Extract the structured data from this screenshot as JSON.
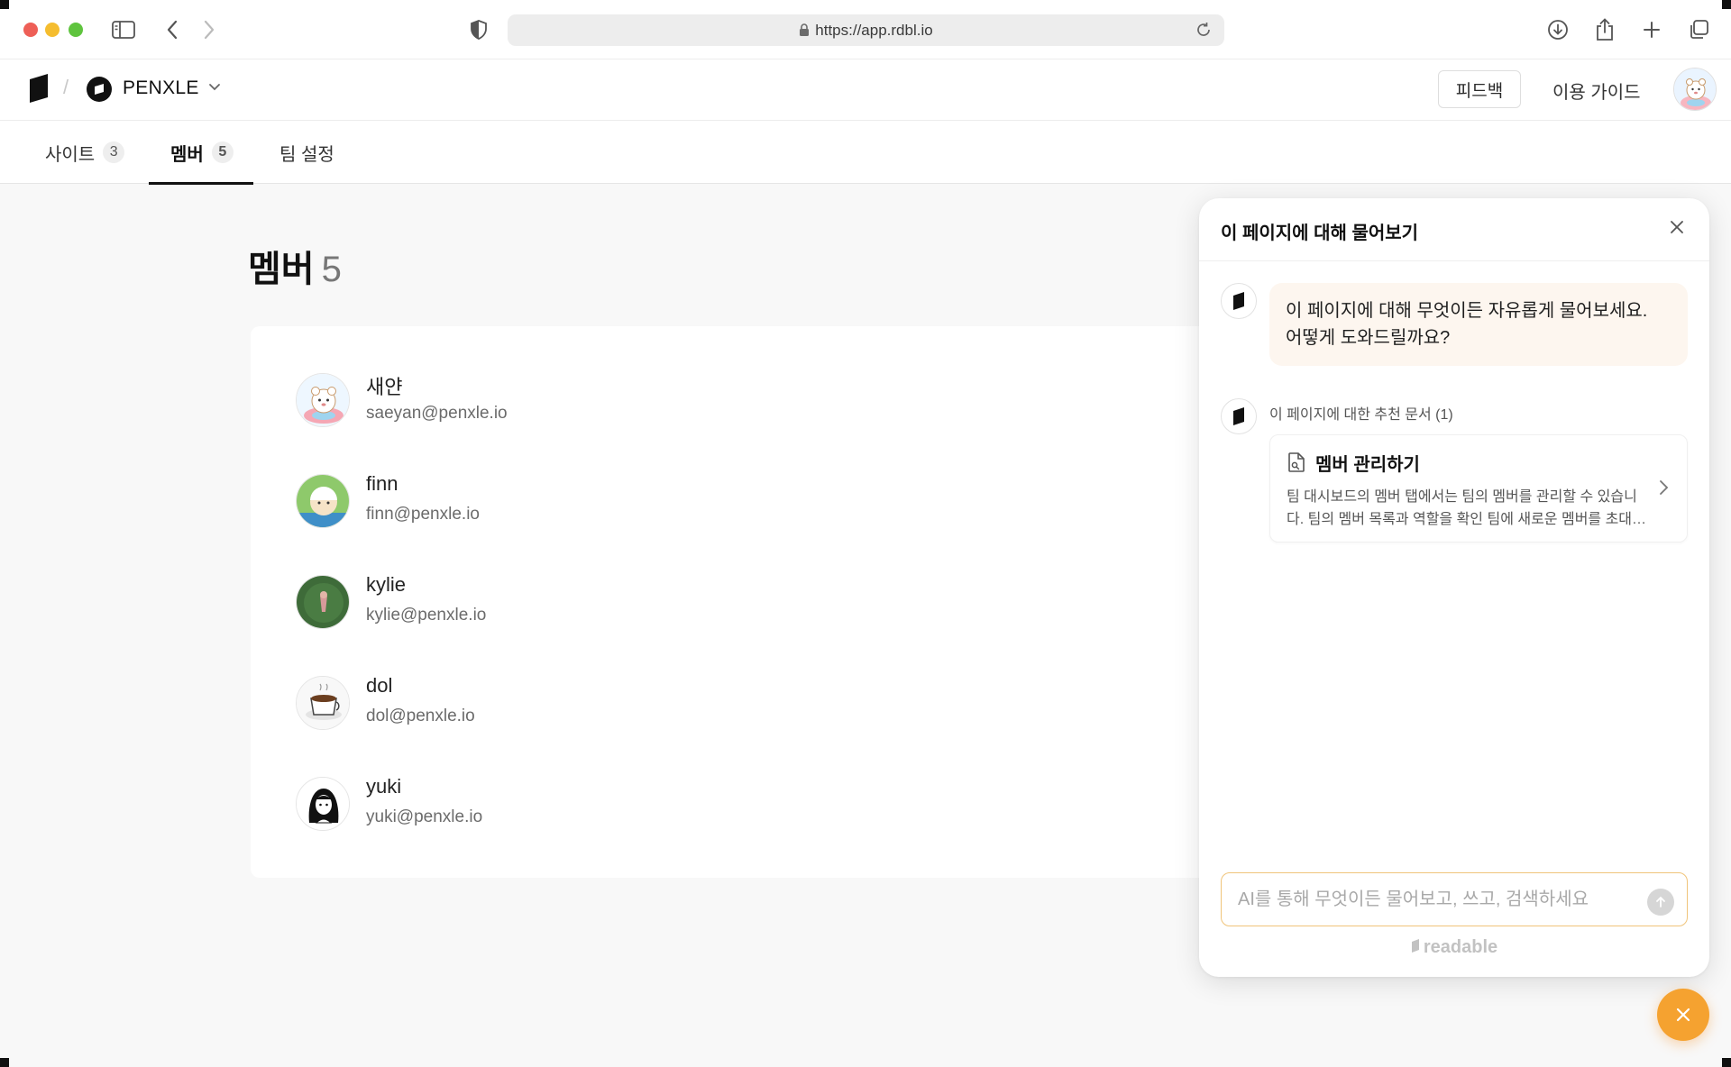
{
  "browser": {
    "url": "https://app.rdbl.io"
  },
  "header": {
    "team_name": "PENXLE",
    "feedback_label": "피드백",
    "guide_label": "이용 가이드"
  },
  "tabs": [
    {
      "label": "사이트",
      "count": "3"
    },
    {
      "label": "멤버",
      "count": "5"
    },
    {
      "label": "팀 설정",
      "count": ""
    }
  ],
  "main": {
    "title": "멤버",
    "count": "5",
    "members": [
      {
        "name": "새얀",
        "email": "saeyan@penxle.io"
      },
      {
        "name": "finn",
        "email": "finn@penxle.io"
      },
      {
        "name": "kylie",
        "email": "kylie@penxle.io"
      },
      {
        "name": "dol",
        "email": "dol@penxle.io"
      },
      {
        "name": "yuki",
        "email": "yuki@penxle.io"
      }
    ]
  },
  "chat": {
    "title": "이 페이지에 대해 물어보기",
    "greeting_line1": "이 페이지에 대해 무엇이든 자유롭게 물어보세요.",
    "greeting_line2": "어떻게 도와드릴까요?",
    "recommend_label": "이 페이지에 대한 추천 문서 (1)",
    "doc": {
      "title": "멤버 관리하기",
      "description": "팀 대시보드의 멤버 탭에서는 팀의 멤버를 관리할 수 있습니다. 팀의 멤버 목록과 역할을 확인 팀에 새로운 멤버를 초대할 수 있습니다."
    },
    "input_placeholder": "AI를 통해 무엇이든 물어보고, 쓰고, 검색하세요",
    "powered_by": "readable"
  },
  "colors": {
    "accent": "#f5a230",
    "bubble_bg": "#fdf6ef",
    "input_border": "#f0c47a"
  }
}
